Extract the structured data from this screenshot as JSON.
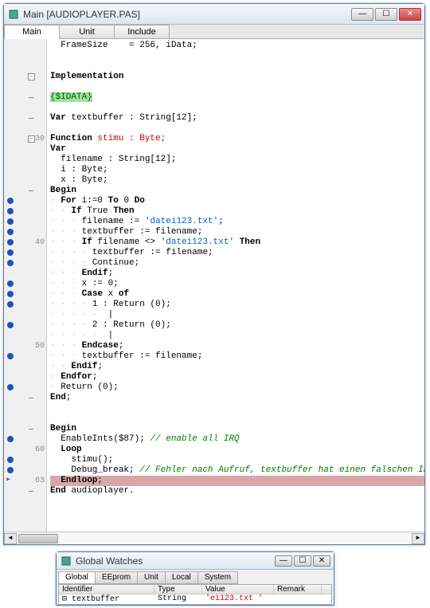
{
  "main_window": {
    "title": "Main [AUDIOPLAYER.PAS]",
    "tabs": [
      "Main",
      "Unit",
      "Include"
    ]
  },
  "code_lines": [
    {
      "n": "",
      "bp": false,
      "fold": "",
      "html": "  FrameSize    = 256, iData;"
    },
    {
      "n": "",
      "bp": false,
      "fold": "",
      "html": ""
    },
    {
      "n": "",
      "bp": false,
      "fold": "",
      "html": ""
    },
    {
      "n": "",
      "bp": false,
      "fold": "-",
      "html": "<span class='kw'>Implementation</span>"
    },
    {
      "n": "",
      "bp": false,
      "fold": "",
      "html": ""
    },
    {
      "n": "",
      "bp": false,
      "fold": "d",
      "html": "<span class='dir'>{$IDATA}</span>"
    },
    {
      "n": "",
      "bp": false,
      "fold": "",
      "html": ""
    },
    {
      "n": "",
      "bp": false,
      "fold": "d",
      "html": "<span class='kw'>Var</span> textbuffer : String[12];"
    },
    {
      "n": "",
      "bp": false,
      "fold": "",
      "html": ""
    },
    {
      "n": "30",
      "bp": false,
      "fold": "-",
      "cls": "hl-red",
      "html": "<span class='kw'>Function</span> stimu : Byte;"
    },
    {
      "n": "",
      "bp": false,
      "fold": "",
      "html": "<span class='kw'>Var</span>"
    },
    {
      "n": "",
      "bp": false,
      "fold": "",
      "html": "  filename : String[12];"
    },
    {
      "n": "",
      "bp": false,
      "fold": "",
      "html": "  i : Byte;"
    },
    {
      "n": "",
      "bp": false,
      "fold": "",
      "html": "  x : Byte;"
    },
    {
      "n": "",
      "bp": false,
      "fold": "d",
      "html": "<span class='kw'>Begin</span>"
    },
    {
      "n": "",
      "bp": true,
      "fold": "",
      "html": "<span class='guide'>·</span> <span class='kw'>For</span> i:=0 <span class='kw'>To</span> 0 <span class='kw'>Do</span>"
    },
    {
      "n": "",
      "bp": true,
      "fold": "",
      "html": "<span class='guide'>· ·</span> <span class='kw'>If</span> True <span class='kw'>Then</span>"
    },
    {
      "n": "",
      "bp": true,
      "fold": "",
      "html": "<span class='guide'>· · ·</span> filename := <span class='str'>'datei123.txt'</span>;"
    },
    {
      "n": "",
      "bp": true,
      "fold": "",
      "html": "<span class='guide'>· · ·</span> textbuffer := filename;"
    },
    {
      "n": "40",
      "bp": true,
      "fold": "",
      "html": "<span class='guide'>· · ·</span> <span class='kw'>If</span> filename &lt;&gt; <span class='str'>'datei123.txt'</span> <span class='kw'>Then</span>"
    },
    {
      "n": "",
      "bp": true,
      "fold": "",
      "html": "<span class='guide'>· · · ·</span> textbuffer := filename;"
    },
    {
      "n": "",
      "bp": true,
      "fold": "",
      "html": "<span class='guide'>· · · ·</span> Continue;"
    },
    {
      "n": "",
      "bp": false,
      "fold": "",
      "html": "<span class='guide'>· · ·</span> <span class='kw'>Endif</span>;"
    },
    {
      "n": "",
      "bp": true,
      "fold": "",
      "html": "<span class='guide'>· · ·</span> x := 0;"
    },
    {
      "n": "",
      "bp": true,
      "fold": "",
      "html": "<span class='guide'>· · ·</span> <span class='kw'>Case</span> x <span class='kw'>of</span>"
    },
    {
      "n": "",
      "bp": true,
      "fold": "",
      "html": "<span class='guide'>· · · ·</span> 1 : Return (0);"
    },
    {
      "n": "",
      "bp": false,
      "fold": "",
      "html": "<span class='guide'>· · · · ·</span>  |"
    },
    {
      "n": "",
      "bp": true,
      "fold": "",
      "html": "<span class='guide'>· · · ·</span> 2 : Return (0);"
    },
    {
      "n": "",
      "bp": false,
      "fold": "",
      "html": "<span class='guide'>· · · · ·</span>  |"
    },
    {
      "n": "50",
      "bp": false,
      "fold": "",
      "html": "<span class='guide'>· · ·</span> <span class='kw'>Endcase</span>;"
    },
    {
      "n": "",
      "bp": true,
      "fold": "",
      "html": "<span class='guide'>· · ·</span> textbuffer := filename;"
    },
    {
      "n": "",
      "bp": false,
      "fold": "",
      "html": "<span class='guide'>· ·</span> <span class='kw'>Endif</span>;"
    },
    {
      "n": "",
      "bp": false,
      "fold": "",
      "html": "<span class='guide'>·</span> <span class='kw'>Endfor</span>;"
    },
    {
      "n": "",
      "bp": true,
      "fold": "",
      "html": "<span class='guide'>·</span> Return (0);"
    },
    {
      "n": "",
      "bp": false,
      "fold": "d",
      "html": "<span class='kw'>End</span>;"
    },
    {
      "n": "",
      "bp": false,
      "fold": "",
      "html": ""
    },
    {
      "n": "",
      "bp": false,
      "fold": "",
      "html": ""
    },
    {
      "n": "",
      "bp": false,
      "fold": "d",
      "html": "<span class='kw'>Begin</span>"
    },
    {
      "n": "",
      "bp": true,
      "fold": "",
      "html": "  EnableInts($87); <span class='cmt'>// enable all IRQ</span>"
    },
    {
      "n": "60",
      "bp": false,
      "fold": "",
      "html": "  <span class='kw'>Loop</span>"
    },
    {
      "n": "",
      "bp": true,
      "fold": "",
      "html": "    stimu();"
    },
    {
      "n": "",
      "bp": true,
      "fold": "",
      "html": "    Debug_break; <span class='cmt'>// Fehler nach Aufruf, textbuffer hat einen falschen Inhalt</span>"
    },
    {
      "n": "63",
      "bp": false,
      "arrow": true,
      "fold": "",
      "cls": "hl-line",
      "html": "  <span class='kw'>Endloop</span>;"
    },
    {
      "n": "",
      "bp": false,
      "fold": "d",
      "html": "<span class='kw'>End</span> audioplayer."
    }
  ],
  "watches": {
    "title": "Global Watches",
    "tabs": [
      "Global",
      "EEprom",
      "Unit",
      "Local",
      "System"
    ],
    "headers": [
      "Identifier",
      "Type",
      "Value",
      "Remark"
    ],
    "rows": [
      {
        "id": "textbuffer",
        "type": "String",
        "value": "'ei123.txt   '",
        "remark": ""
      }
    ]
  }
}
